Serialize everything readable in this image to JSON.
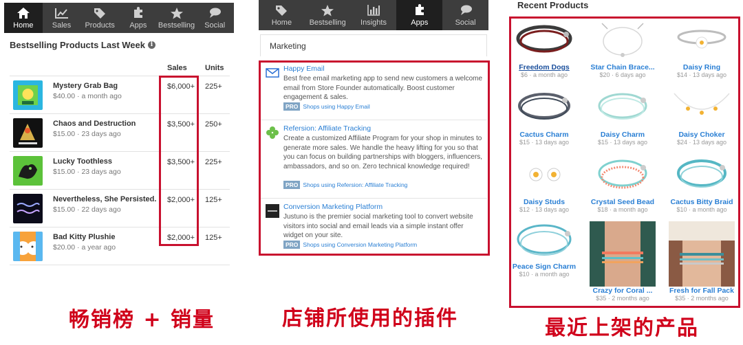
{
  "panel1": {
    "nav": [
      {
        "label": "Home",
        "icon": "home-icon",
        "active": true
      },
      {
        "label": "Sales",
        "icon": "chart-line-icon",
        "active": false
      },
      {
        "label": "Products",
        "icon": "tag-icon",
        "active": false
      },
      {
        "label": "Apps",
        "icon": "puzzle-icon",
        "active": false
      },
      {
        "label": "Bestselling",
        "icon": "star-icon",
        "active": false
      },
      {
        "label": "Social",
        "icon": "speech-bubble-icon",
        "active": false
      }
    ],
    "title": "Bestselling Products Last Week",
    "columns": {
      "sales": "Sales",
      "units": "Units"
    },
    "rows": [
      {
        "name": "Mystery Grab Bag",
        "meta": "$40.00 · a month ago",
        "sales": "$6,000+",
        "units": "225+"
      },
      {
        "name": "Chaos and Destruction",
        "meta": "$15.00 · 23 days ago",
        "sales": "$3,500+",
        "units": "250+"
      },
      {
        "name": "Lucky Toothless",
        "meta": "$15.00 · 23 days ago",
        "sales": "$3,500+",
        "units": "225+"
      },
      {
        "name": "Nevertheless, She Persisted.",
        "meta": "$15.00 · 22 days ago",
        "sales": "$2,000+",
        "units": "125+"
      },
      {
        "name": "Bad Kitty Plushie",
        "meta": "$20.00 · a year ago",
        "sales": "$2,000+",
        "units": "125+"
      }
    ],
    "caption": "畅销榜 + 销量"
  },
  "panel2": {
    "nav": [
      {
        "label": "Home",
        "icon": "tag-icon",
        "active": false
      },
      {
        "label": "Bestselling",
        "icon": "star-icon",
        "active": false
      },
      {
        "label": "Insights",
        "icon": "bar-chart-icon",
        "active": false
      },
      {
        "label": "Apps",
        "icon": "puzzle-icon",
        "active": true
      },
      {
        "label": "Social",
        "icon": "speech-bubble-icon",
        "active": false
      }
    ],
    "section": "Marketing",
    "apps": [
      {
        "title": "Happy Email",
        "desc": "Best free email marketing app to send new customers a welcome email from Store Founder automatically. Boost customer engagement & sales.",
        "badge": "PRO",
        "shops": "Shops using Happy Email"
      },
      {
        "title": "Refersion: Affiliate Tracking",
        "desc": "Create a customized Affiliate Program for your shop in minutes to generate more sales. We handle the heavy lifting for you so that you can focus on building partnerships with bloggers, influencers, ambassadors, and so on. Zero technical knowledge required!",
        "badge": "PRO",
        "shops": "Shops using Refersion: Affiliate Tracking"
      },
      {
        "title": "Conversion Marketing Platform",
        "desc": "Justuno is the premier social marketing tool to convert website visitors into social and email leads via a simple instant offer widget on your site.",
        "badge": "PRO",
        "shops": "Shops using Conversion Marketing Platform"
      }
    ],
    "caption": "店铺所使用的插件"
  },
  "panel3": {
    "heading": "Recent Products",
    "products": [
      {
        "name": "Freedom Dogs",
        "meta": "$6 · a month ago"
      },
      {
        "name": "Star Chain Brace...",
        "meta": "$20 · 6 days ago"
      },
      {
        "name": "Daisy Ring",
        "meta": "$14 · 13 days ago"
      },
      {
        "name": "Cactus Charm",
        "meta": "$15 · 13 days ago"
      },
      {
        "name": "Daisy Charm",
        "meta": "$15 · 13 days ago"
      },
      {
        "name": "Daisy Choker",
        "meta": "$24 · 13 days ago"
      },
      {
        "name": "Daisy Studs",
        "meta": "$12 · 13 days ago"
      },
      {
        "name": "Crystal Seed Bead",
        "meta": "$18 · a month ago"
      },
      {
        "name": "Cactus Bitty Braid",
        "meta": "$10 · a month ago"
      },
      {
        "name": "Peace Sign Charm",
        "meta": "$10 · a month ago"
      },
      {
        "name": "Crazy for Coral ...",
        "meta": "$35 · 2 months ago"
      },
      {
        "name": "Fresh for Fall Pack",
        "meta": "$35 · 2 months ago"
      }
    ],
    "caption": "最近上架的产品"
  },
  "colors": {
    "accent_red": "#c8102e",
    "link_blue": "#2a7fd4",
    "nav_bg": "#3d3d3d",
    "nav_active": "#1f1f1f"
  }
}
